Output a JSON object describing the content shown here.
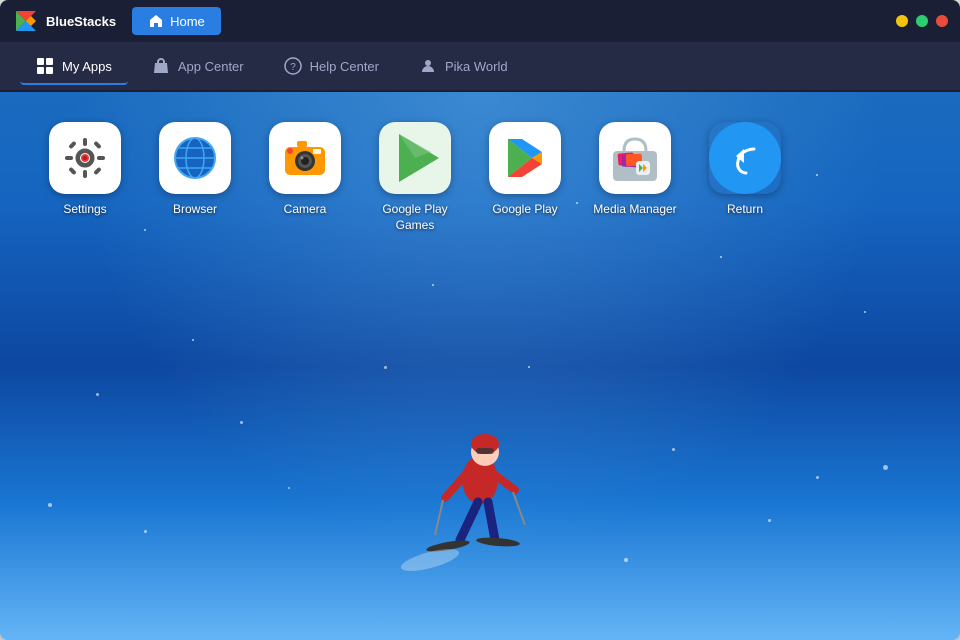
{
  "titleBar": {
    "appName": "BlueStacks",
    "homeTab": "Home"
  },
  "navBar": {
    "items": [
      {
        "id": "my-apps",
        "label": "My Apps",
        "icon": "grid-icon",
        "active": true
      },
      {
        "id": "app-center",
        "label": "App Center",
        "icon": "bag-icon",
        "active": false
      },
      {
        "id": "help-center",
        "label": "Help Center",
        "icon": "question-icon",
        "active": false
      },
      {
        "id": "pika-world",
        "label": "Pika World",
        "icon": "person-icon",
        "active": false
      }
    ]
  },
  "apps": [
    {
      "id": "settings",
      "label": "Settings"
    },
    {
      "id": "browser",
      "label": "Browser"
    },
    {
      "id": "camera",
      "label": "Camera"
    },
    {
      "id": "google-play-games",
      "label": "Google Play Games"
    },
    {
      "id": "google-play",
      "label": "Google Play"
    },
    {
      "id": "media-manager",
      "label": "Media Manager"
    },
    {
      "id": "return",
      "label": "Return"
    }
  ],
  "background": {
    "skyColor": "#1565c0"
  }
}
